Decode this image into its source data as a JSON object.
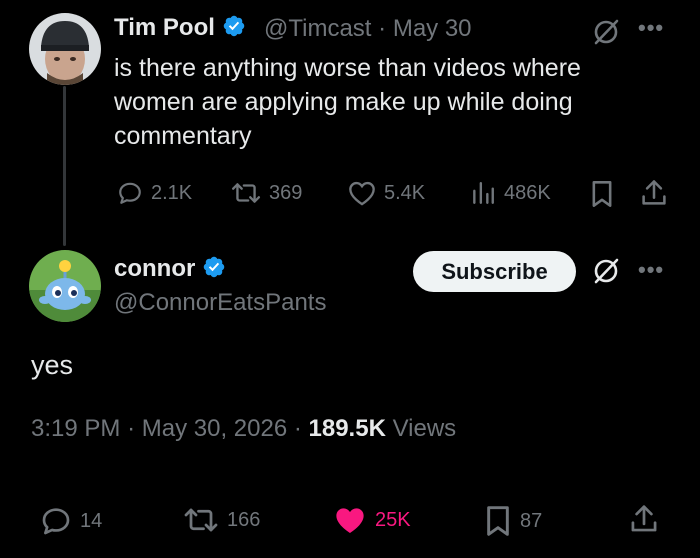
{
  "parent_tweet": {
    "author_name": "Tim Pool",
    "handle": "@Timcast",
    "separator": "·",
    "date": "May 30",
    "text_lines": [
      "is there anything worse than videos where",
      "women are applying make up while doing",
      "commentary"
    ],
    "replies": "2.1K",
    "reposts": "369",
    "likes": "5.4K",
    "views": "486K"
  },
  "reply_tweet": {
    "author_name": "connor",
    "handle": "@ConnorEatsPants",
    "subscribe_label": "Subscribe",
    "text": "yes",
    "time": "3:19 PM",
    "sep1": "·",
    "full_date": "May 30, 2026",
    "sep2": "·",
    "views_count": "189.5K",
    "views_label": "Views",
    "replies": "14",
    "reposts": "166",
    "likes": "25K",
    "bookmarks": "87"
  },
  "colors": {
    "background": "#000000",
    "text": "#e7e9ea",
    "muted": "#71767b",
    "verified": "#1d9bf0",
    "liked": "#f91880"
  },
  "icons": [
    "grok-icon",
    "more-icon",
    "reply-icon",
    "repost-icon",
    "like-icon",
    "views-icon",
    "bookmark-icon",
    "share-icon",
    "verified-icon"
  ]
}
